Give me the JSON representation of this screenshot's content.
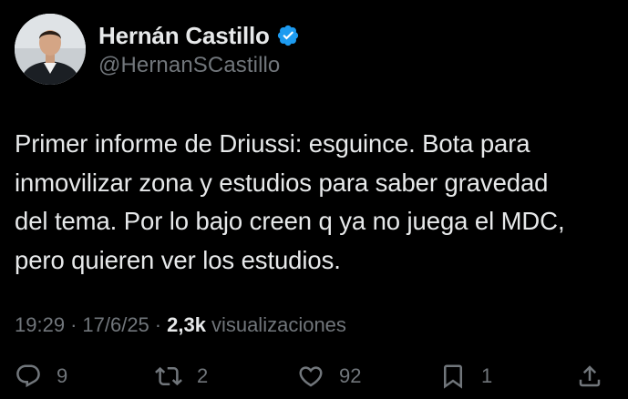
{
  "author": {
    "display_name": "Hernán Castillo",
    "handle": "@HernanSCastillo",
    "verified_icon": "verified-badge-icon",
    "verified_color": "#1d9bf0"
  },
  "tweet": {
    "text": "Primer informe de Driussi: esguince. Bota para\ninmovilizar zona y estudios para saber gravedad\ndel tema. Por lo bajo creen q ya no juega el MDC,\npero quieren ver los estudios."
  },
  "meta": {
    "time": "19:29",
    "separator": "·",
    "date": "17/6/25",
    "views_count": "2,3k",
    "views_label": "visualizaciones"
  },
  "actions": {
    "reply": {
      "icon": "reply-icon",
      "count": "9"
    },
    "retweet": {
      "icon": "retweet-icon",
      "count": "2"
    },
    "like": {
      "icon": "heart-icon",
      "count": "92"
    },
    "bookmark": {
      "icon": "bookmark-icon",
      "count": "1"
    },
    "share": {
      "icon": "share-icon"
    }
  },
  "colors": {
    "background": "#000000",
    "primary_text": "#e7e9ea",
    "secondary_text": "#71767b",
    "accent": "#1d9bf0"
  }
}
